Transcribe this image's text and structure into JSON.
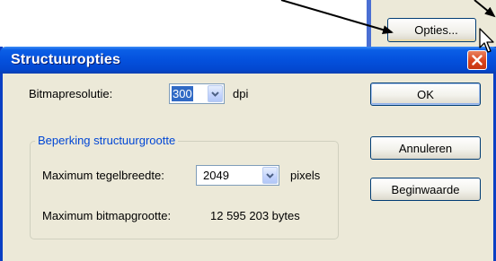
{
  "background_window": {
    "opties_button_label": "Opties..."
  },
  "dialog": {
    "title": "Structuuropties",
    "close_icon": "close-x-icon",
    "bitmap_resolution": {
      "label": "Bitmapresolutie:",
      "value": "300",
      "unit": "dpi"
    },
    "group": {
      "legend": "Beperking structuurgrootte",
      "max_tile_width": {
        "label": "Maximum tegelbreedte:",
        "value": "2049",
        "unit": "pixels"
      },
      "max_bitmap_size": {
        "label": "Maximum bitmapgrootte:",
        "value": "12 595 203 bytes"
      }
    },
    "buttons": {
      "ok": "OK",
      "cancel": "Annuleren",
      "defaults": "Beginwaarde"
    }
  },
  "colors": {
    "titlebar": "#0451dd",
    "dialog_face": "#ece9d8",
    "group_legend": "#0046d5",
    "selection": "#316ac5",
    "close_button": "#d8431c"
  }
}
